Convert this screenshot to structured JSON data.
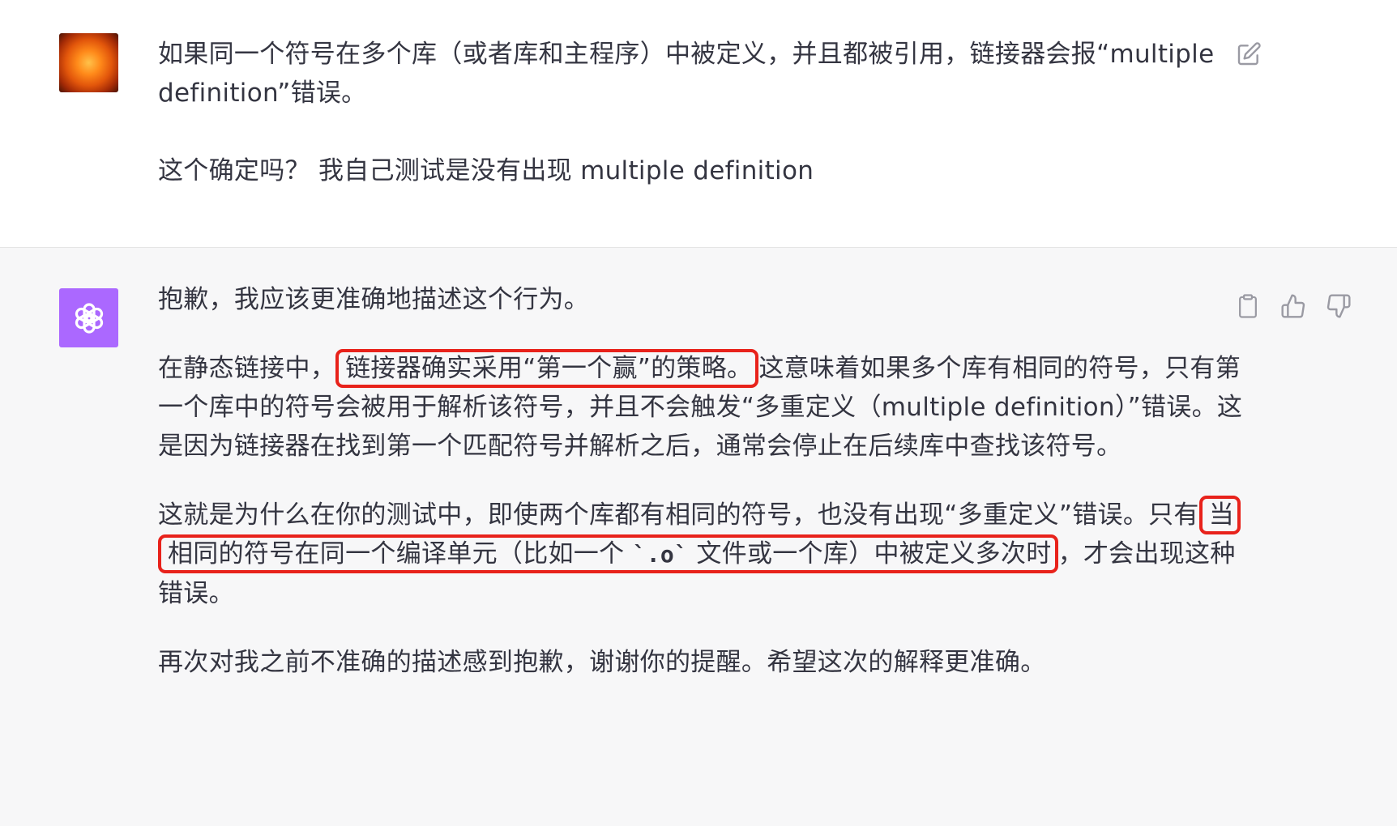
{
  "user_message": {
    "avatar_icon": "sun-avatar-icon",
    "paragraph_1": "如果同一个符号在多个库（或者库和主程序）中被定义，并且都被引用，链接器会报“multiple definition”错误。",
    "paragraph_2": "这个确定吗？ 我自己测试是没有出现 multiple definition",
    "edit_icon": "edit-icon"
  },
  "assistant_message": {
    "avatar_icon": "openai-logo-icon",
    "avatar_color": "#ab68ff",
    "paragraph_1": "抱歉，我应该更准确地描述这个行为。",
    "paragraph_2": {
      "before": "在静态链接中，",
      "highlight": "链接器确实采用“第一个赢”的策略。",
      "after": "这意味着如果多个库有相同的符号，只有第一个库中的符号会被用于解析该符号，并且不会触发“多重定义（multiple definition）”错误。这是因为链接器在找到第一个匹配符号并解析之后，通常会停止在后续库中查找该符号。"
    },
    "paragraph_3": {
      "before": "这就是为什么在你的测试中，即使两个库都有相同的符号，也没有出现“多重定义”错误。只有",
      "highlight_before_code": "当相同的符号在同一个编译单元（比如一个 ",
      "code": "`.o`",
      "highlight_after_code": " 文件或一个库）中被定义多次时",
      "after": "，才会出现这种错误。"
    },
    "paragraph_4": "再次对我之前不准确的描述感到抱歉，谢谢你的提醒。希望这次的解释更准确。",
    "action_icons": [
      "clipboard-icon",
      "thumbs-up-icon",
      "thumbs-down-icon"
    ],
    "highlight_color": "#e8221b"
  }
}
